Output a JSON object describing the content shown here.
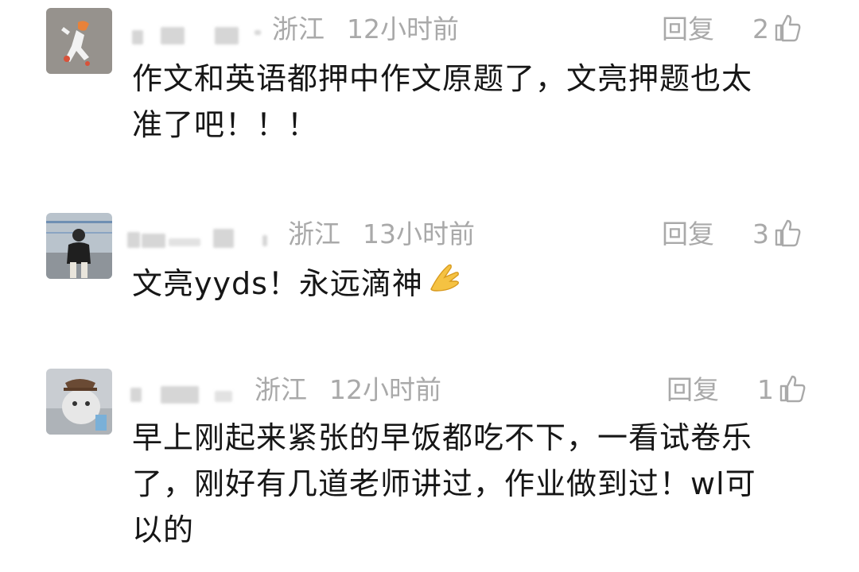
{
  "comments": [
    {
      "region": "浙江",
      "time": "12小时前",
      "reply_label": "回复",
      "likes": "2",
      "lines": [
        "作文和英语都押中作文原题了，文亮押题也太",
        "准了吧！！！"
      ]
    },
    {
      "region": "浙江",
      "time": "13小时前",
      "reply_label": "回复",
      "likes": "3",
      "lines": [
        "文亮yyds！永远滴神"
      ]
    },
    {
      "region": "浙江",
      "time": "12小时前",
      "reply_label": "回复",
      "likes": "1",
      "lines": [
        "早上刚起来紧张的早饭都吃不下，一看试卷乐",
        "了，刚好有几道老师讲过，作业做到过！wl可",
        "以的"
      ]
    }
  ],
  "icons": {
    "like": "thumbs-up-icon",
    "emoji": "pray-hands-emoji"
  }
}
